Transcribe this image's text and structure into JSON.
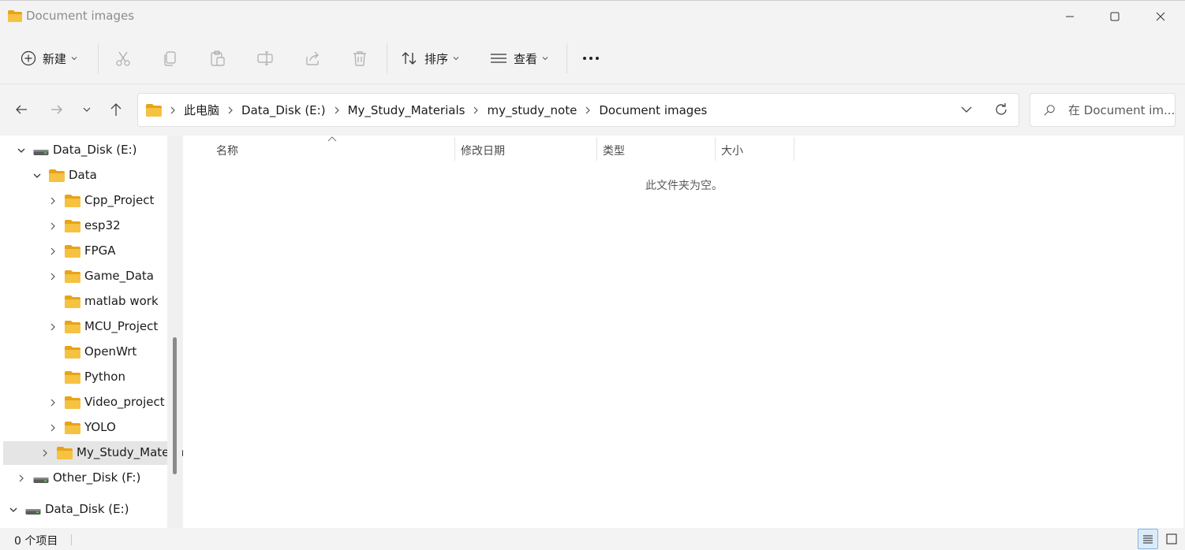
{
  "window": {
    "title": "Document images"
  },
  "toolbar": {
    "new_label": "新建",
    "sort_label": "排序",
    "view_label": "查看"
  },
  "address": {
    "crumbs": [
      "此电脑",
      "Data_Disk (E:)",
      "My_Study_Materials",
      "my_study_note",
      "Document images"
    ]
  },
  "search": {
    "placeholder": "在 Document im..."
  },
  "nav": {
    "items": [
      {
        "label": "Data_Disk (E:)",
        "icon": "drive-icon",
        "expanded": true
      },
      {
        "label": "Data",
        "icon": "folder-icon",
        "expanded": true
      },
      {
        "label": "Cpp_Project",
        "icon": "folder-icon",
        "expanded": false
      },
      {
        "label": "esp32",
        "icon": "folder-icon",
        "expanded": false
      },
      {
        "label": "FPGA",
        "icon": "folder-icon",
        "expanded": false
      },
      {
        "label": "Game_Data",
        "icon": "folder-icon",
        "expanded": false
      },
      {
        "label": "matlab work",
        "icon": "folder-icon",
        "expanded": null
      },
      {
        "label": "MCU_Project",
        "icon": "folder-icon",
        "expanded": false
      },
      {
        "label": "OpenWrt",
        "icon": "folder-icon",
        "expanded": null
      },
      {
        "label": "Python",
        "icon": "folder-icon",
        "expanded": null
      },
      {
        "label": "Video_project",
        "icon": "folder-icon",
        "expanded": false
      },
      {
        "label": "YOLO",
        "icon": "folder-icon",
        "expanded": false
      },
      {
        "label": "My_Study_Materia",
        "icon": "folder-icon",
        "expanded": false,
        "selected": true
      },
      {
        "label": "Other_Disk (F:)",
        "icon": "drive-icon",
        "expanded": false
      },
      {
        "label": "Data_Disk (E:)",
        "icon": "drive-icon",
        "expanded": true
      }
    ]
  },
  "columns": {
    "name": "名称",
    "modified": "修改日期",
    "type": "类型",
    "size": "大小"
  },
  "content": {
    "empty_message": "此文件夹为空。"
  },
  "status": {
    "item_count": "0 个项目"
  },
  "colors": {
    "folder": "#f5c242",
    "selected_bg": "#e5e5e5",
    "accent": "#0067c0"
  }
}
